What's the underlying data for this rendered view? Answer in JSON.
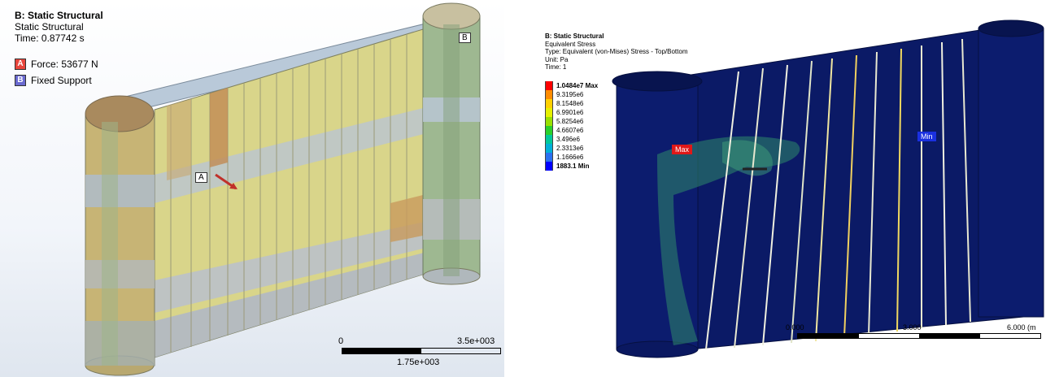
{
  "left_panel": {
    "title": "B: Static Structural",
    "subtitle": "Static Structural",
    "time": "Time: 0.87742 s",
    "legend": [
      {
        "key": "A",
        "label": "Force: 53677 N",
        "color": "#e8453c"
      },
      {
        "key": "B",
        "label": "Fixed Support",
        "color": "#6a6ad0"
      }
    ],
    "markers": {
      "a": "A",
      "b": "B"
    },
    "scale": {
      "start": "0",
      "end": "3.5e+003",
      "mid": "1.75e+003"
    }
  },
  "right_panel": {
    "title": "B: Static Structural",
    "lines": [
      "Equivalent Stress",
      "Type: Equivalent (von-Mises) Stress - Top/Bottom",
      "Unit: Pa",
      "Time: 1"
    ],
    "contour_levels": [
      {
        "label": "1.0484e7 Max",
        "color": "#ff0000",
        "bold": true
      },
      {
        "label": "9.3195e6",
        "color": "#ff8c00",
        "bold": false
      },
      {
        "label": "8.1548e6",
        "color": "#ffd000",
        "bold": false
      },
      {
        "label": "6.9901e6",
        "color": "#e6f000",
        "bold": false
      },
      {
        "label": "5.8254e6",
        "color": "#9ae000",
        "bold": false
      },
      {
        "label": "4.6607e6",
        "color": "#2ad02a",
        "bold": false
      },
      {
        "label": "3.496e6",
        "color": "#00c89a",
        "bold": false
      },
      {
        "label": "2.3313e6",
        "color": "#00b0d8",
        "bold": false
      },
      {
        "label": "1.1666e6",
        "color": "#2a70f0",
        "bold": false
      },
      {
        "label": "1883.1 Min",
        "color": "#0000ff",
        "bold": true
      }
    ],
    "probes": {
      "max": "Max",
      "min": "Min"
    },
    "scale": {
      "start": "0.000",
      "mid": "3.000",
      "end": "6.000 (m"
    }
  },
  "colors": {
    "ansys_dark_blue": "#0b1a66",
    "mesh_tan": "#c9b67a",
    "mesh_green": "#9db884"
  }
}
